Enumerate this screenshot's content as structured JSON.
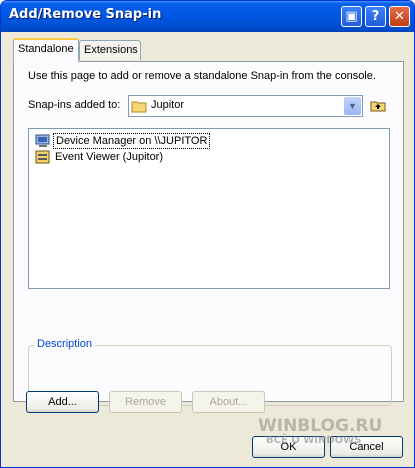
{
  "window": {
    "title": "Add/Remove Snap-in"
  },
  "titlebar_buttons": [
    "▣",
    "?",
    "✕"
  ],
  "tabs": [
    {
      "label": "Standalone",
      "active": true
    },
    {
      "label": "Extensions",
      "active": false
    }
  ],
  "standalone": {
    "intro": "Use this page to add or remove a standalone Snap-in from the console.",
    "snapins_added_to_label": "Snap-ins added to:",
    "selected_location": "Jupitor",
    "items": [
      {
        "label": "Device Manager on \\\\JUPITOR",
        "icon": "device-manager-icon",
        "selected": true
      },
      {
        "label": "Event Viewer (Jupitor)",
        "icon": "event-viewer-icon",
        "selected": false
      }
    ],
    "description_label": "Description",
    "description_text": "",
    "buttons": {
      "add": "Add...",
      "remove": "Remove",
      "about": "About..."
    }
  },
  "footer": {
    "ok": "OK",
    "cancel": "Cancel"
  },
  "watermark": {
    "line1": "WINBLOG.RU",
    "line2": "ВСЁ О WINDOWS"
  },
  "colors": {
    "titlebar": "#0058e6",
    "accent_tab": "#ffc83c",
    "legend": "#0046d5"
  }
}
